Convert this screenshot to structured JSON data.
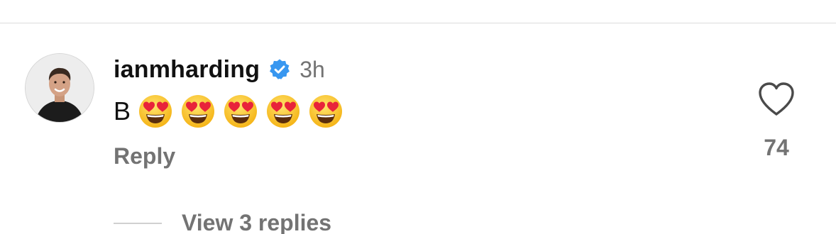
{
  "comment": {
    "username": "ianmharding",
    "verified_icon": "verified-badge-icon",
    "timestamp": "3h",
    "text": "B",
    "emoji_icon": "smiling-face-with-heart-eyes-icon",
    "reply_label": "Reply",
    "like_icon": "heart-outline-icon",
    "like_count": "74",
    "view_replies_label": "View 3 replies"
  },
  "colors": {
    "verified_blue": "#3897f0",
    "muted_text": "#737373",
    "emoji_face": "#f9c21a",
    "emoji_heart": "#e8233a"
  }
}
